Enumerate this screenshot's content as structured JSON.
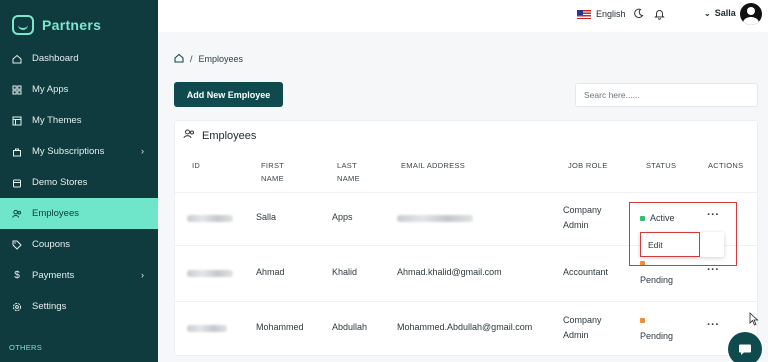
{
  "brand": {
    "name": "Partners"
  },
  "sidebar": {
    "items": [
      {
        "label": "Dashboard",
        "icon": "home-icon"
      },
      {
        "label": "My Apps",
        "icon": "grid-icon"
      },
      {
        "label": "My Themes",
        "icon": "layout-icon"
      },
      {
        "label": "My Subscriptions",
        "icon": "bag-icon",
        "chevron": true
      },
      {
        "label": "Demo Stores",
        "icon": "store-icon"
      },
      {
        "label": "Employees",
        "icon": "users-icon",
        "active": true
      },
      {
        "label": "Coupons",
        "icon": "tag-icon"
      },
      {
        "label": "Payments",
        "icon": "dollar-icon",
        "chevron": true
      },
      {
        "label": "Settings",
        "icon": "gear-icon"
      }
    ],
    "section_label": "OTHERS"
  },
  "topbar": {
    "language": "English",
    "user_name": "Salla"
  },
  "breadcrumb": {
    "current": "Employees"
  },
  "actions": {
    "add_label": "Add New Employee",
    "search_placeholder": "Searc here......"
  },
  "card": {
    "title": "Employees"
  },
  "table": {
    "headers": {
      "id": "ID",
      "first_name_1": "FIRST",
      "first_name_2": "NAME",
      "last_name_1": "LAST",
      "last_name_2": "NAME",
      "email": "EMAIL ADDRESS",
      "role": "JOB ROLE",
      "status": "STATUS",
      "actions": "ACTIONS"
    },
    "rows": [
      {
        "first": "Salla",
        "last": "Apps",
        "email": "",
        "role_1": "Company",
        "role_2": "Admin",
        "status": "Active",
        "status_color": "#2fbf71"
      },
      {
        "first": "Ahmad",
        "last": "Khalid",
        "email": "Ahmad.khalid@gmail.com",
        "role_1": "Accountant",
        "role_2": "",
        "status": "Pending",
        "status_color": "#f28c38"
      },
      {
        "first": "Mohammed",
        "last": "Abdullah",
        "email": "Mohammed.Abdullah@gmail.com",
        "role_1": "Company",
        "role_2": "Admin",
        "status": "Pending",
        "status_color": "#f28c38"
      }
    ],
    "row_menu": {
      "edit_label": "Edit"
    }
  },
  "colors": {
    "sidebar_bg": "#0f3b3f",
    "accent": "#6fe5c9",
    "primary_button": "#0f4a4e",
    "highlight": "#d23b3b"
  }
}
